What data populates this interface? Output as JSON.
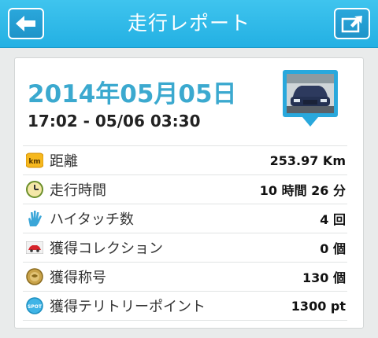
{
  "header": {
    "title": "走行レポート",
    "back_icon": "back-arrow-icon",
    "share_icon": "share-icon"
  },
  "report": {
    "date": "2014年05月05日",
    "time_range": "17:02 - 05/06 03:30",
    "thumbnail": "car-photo-pin"
  },
  "stats": [
    {
      "icon": "km-badge-icon",
      "icon_text": "km",
      "label": "距離",
      "value": "253.97 Km"
    },
    {
      "icon": "clock-icon",
      "label": "走行時間",
      "value": "10 時間 26 分"
    },
    {
      "icon": "high-five-hand-icon",
      "label": "ハイタッチ数",
      "value": "4 回"
    },
    {
      "icon": "car-collection-icon",
      "label": "獲得コレクション",
      "value": "0 個"
    },
    {
      "icon": "title-medal-icon",
      "label": "獲得称号",
      "value": "130 個"
    },
    {
      "icon": "spot-badge-icon",
      "icon_text": "SPOT",
      "label": "獲得テリトリーポイント",
      "value": "1300 pt"
    }
  ],
  "colors": {
    "header": "#23b0e3",
    "date": "#3ba9cf",
    "background": "#e9ebeb"
  }
}
